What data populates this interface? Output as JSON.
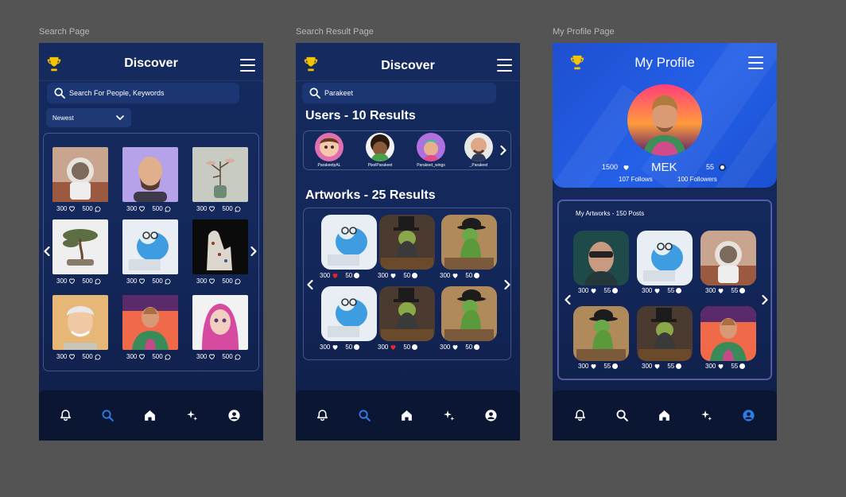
{
  "labels": {
    "search_page": "Search Page",
    "result_page": "Search Result Page",
    "profile_page": "My Profile Page"
  },
  "colors": {
    "background": "#545454",
    "phone_bg": "#13275a",
    "accent_blue": "#2b7de8",
    "trophy_yellow": "#f5c400",
    "heart_red": "#e8262c"
  },
  "search_page": {
    "title": "Discover",
    "search_placeholder": "Search For People, Keywords",
    "sort_value": "Newest",
    "items": [
      {
        "likes": "300",
        "comments": "500",
        "art": "astronaut-cat"
      },
      {
        "likes": "300",
        "comments": "500",
        "art": "bald-man"
      },
      {
        "likes": "300",
        "comments": "500",
        "art": "plant-vase"
      },
      {
        "likes": "300",
        "comments": "500",
        "art": "bonsai"
      },
      {
        "likes": "300",
        "comments": "500",
        "art": "parakeet-laptop"
      },
      {
        "likes": "300",
        "comments": "500",
        "art": "porcelain-dog"
      },
      {
        "likes": "300",
        "comments": "500",
        "art": "old-man"
      },
      {
        "likes": "300",
        "comments": "500",
        "art": "man-jacket"
      },
      {
        "likes": "300",
        "comments": "500",
        "art": "pink-hair-girl"
      }
    ]
  },
  "result_page": {
    "title": "Discover",
    "search_value": "Parakeet",
    "users_heading": "Users - 10 Results",
    "users": [
      {
        "name": "ParakeetpAL"
      },
      {
        "name": "PixelParakeet"
      },
      {
        "name": "Parakeet_wings"
      },
      {
        "name": "_Parakeet"
      }
    ],
    "artworks_heading": "Artworks - 25 Results",
    "artworks": [
      {
        "likes": "300",
        "comments": "50",
        "liked": true,
        "art": "parakeet-laptop"
      },
      {
        "likes": "300",
        "comments": "50",
        "liked": false,
        "art": "parakeet-tophat"
      },
      {
        "likes": "300",
        "comments": "50",
        "liked": false,
        "art": "parakeet-bowler"
      },
      {
        "likes": "300",
        "comments": "50",
        "liked": false,
        "art": "parakeet-laptop"
      },
      {
        "likes": "300",
        "comments": "50",
        "liked": true,
        "art": "parakeet-tophat"
      },
      {
        "likes": "300",
        "comments": "50",
        "liked": false,
        "art": "parakeet-bowler"
      }
    ]
  },
  "profile_page": {
    "title": "My Profile",
    "username": "MEK",
    "likes": "1500",
    "comments": "55",
    "follows": "107 Follows",
    "followers": "100 Followers",
    "artworks_heading": "My Artworks - 150 Posts",
    "artworks": [
      {
        "likes": "300",
        "comments": "55",
        "art": "man-sunglasses"
      },
      {
        "likes": "300",
        "comments": "55",
        "art": "parakeet-laptop"
      },
      {
        "likes": "300",
        "comments": "55",
        "art": "astronaut-cat"
      },
      {
        "likes": "300",
        "comments": "55",
        "art": "parakeet-bowler"
      },
      {
        "likes": "300",
        "comments": "55",
        "art": "parakeet-tophat"
      },
      {
        "likes": "300",
        "comments": "55",
        "art": "man-jacket"
      }
    ]
  },
  "nav_icons": [
    "bell-icon",
    "search-icon",
    "home-icon",
    "sparkle-icon",
    "user-icon"
  ]
}
